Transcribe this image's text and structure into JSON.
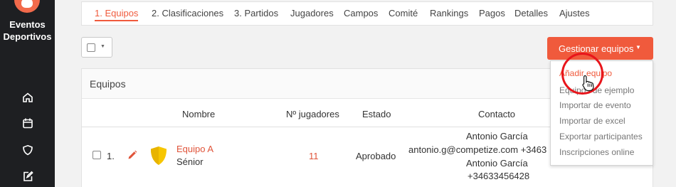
{
  "sidebar": {
    "brand_line1": "Eventos",
    "brand_line2": "Deportivos",
    "icons": [
      "home-icon",
      "calendar-icon",
      "shield-icon",
      "edit-icon"
    ]
  },
  "tabs": [
    {
      "label": "1. Equipos",
      "active": true
    },
    {
      "label": "2. Clasificaciones"
    },
    {
      "label": "3. Partidos"
    },
    {
      "label": "Jugadores"
    },
    {
      "label": "Campos"
    },
    {
      "label": "Comité"
    },
    {
      "label": "Rankings"
    },
    {
      "label": "Pagos"
    },
    {
      "label": "Detalles"
    },
    {
      "label": "Ajustes"
    }
  ],
  "toolbar": {
    "manage_label": "Gestionar equipos"
  },
  "panel": {
    "title": "Equipos",
    "columns": [
      "Nombre",
      "Nº jugadores",
      "Estado",
      "Contacto"
    ],
    "rows": [
      {
        "index": "1.",
        "name": "Equipo A",
        "category": "Sénior",
        "players": "11",
        "status": "Aprobado",
        "contact_name_1": "Antonio García",
        "contact_email": "antonio.g@competize.com +3463",
        "contact_name_2": "Antonio García",
        "contact_phone": "+34633456428"
      }
    ]
  },
  "dropdown": {
    "items": [
      "Añadir equipo",
      "Equipos de ejemplo",
      "Importar de evento",
      "Importar de excel",
      "Exportar participantes",
      "Inscripciones online"
    ]
  },
  "colors": {
    "accent": "#f05a3c",
    "sidebar": "#1e1f22",
    "highlight": "#e8151b"
  }
}
